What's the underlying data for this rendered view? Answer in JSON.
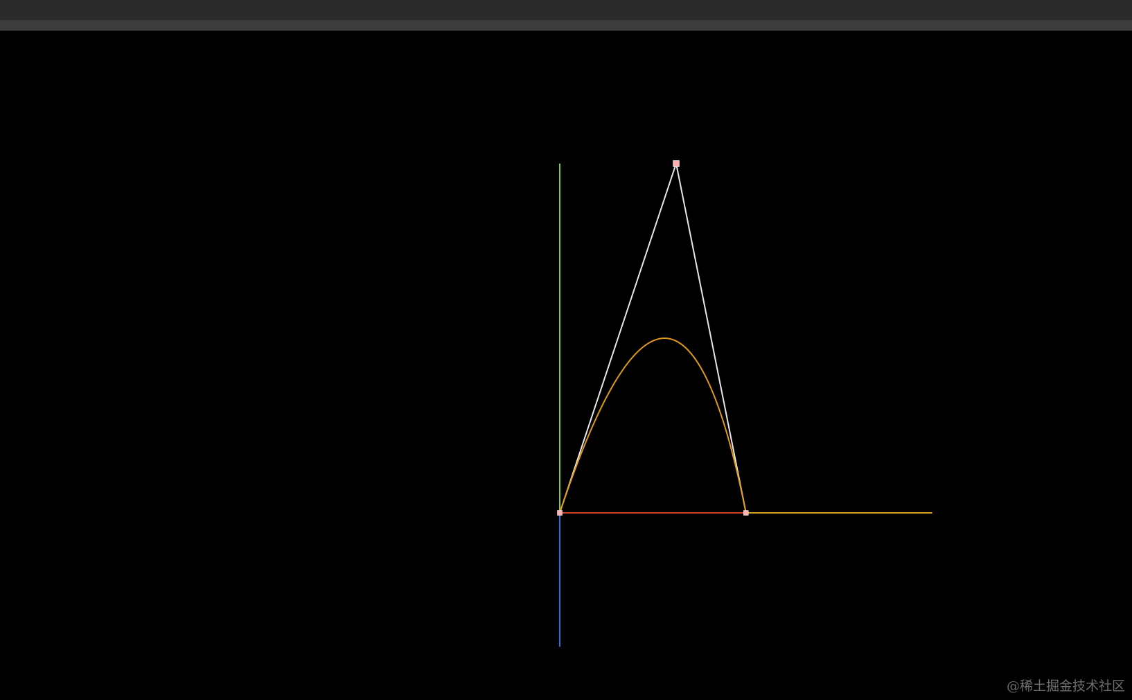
{
  "window": {
    "title": ""
  },
  "scene": {
    "description_free": true,
    "colors": {
      "background": "#000000",
      "axis_x_positive": "#cc4422",
      "axis_x_far": "#d8a020",
      "axis_y_positive": "#88cc22",
      "axis_z_negative": "#2a6fd6",
      "control_polygon": "#e8e8e8",
      "bezier_curve": "#e09a1a",
      "control_point_fill": "#ffb0b0"
    },
    "control_points": [
      {
        "id": "p0",
        "x": 0,
        "y": 0
      },
      {
        "id": "p1",
        "x": 1,
        "y": 3
      },
      {
        "id": "p2",
        "x": 1.6,
        "y": 0
      }
    ],
    "axis_extent": {
      "x": 3.2,
      "y": 3,
      "z_down": 1.15
    }
  },
  "watermark": {
    "text": "@稀土掘金技术社区"
  }
}
